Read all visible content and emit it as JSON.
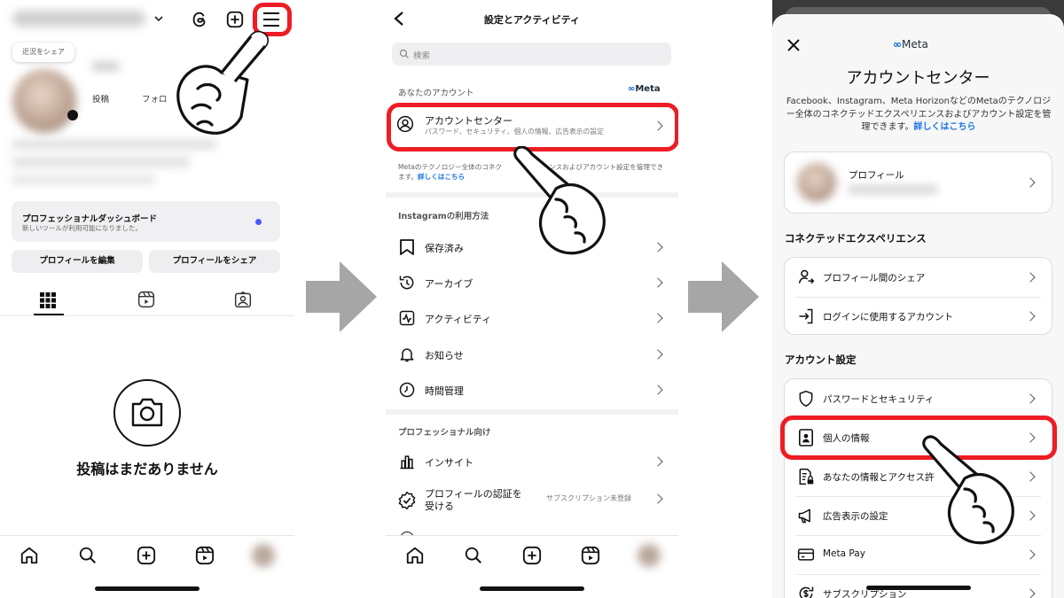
{
  "colors": {
    "accent_red": "#ee1c24",
    "meta_blue": "#0064e0",
    "link_blue": "#1a74e4",
    "arrow_gray": "#a6a6a6",
    "dot_blue": "#4a5cf0"
  },
  "profile_screen": {
    "note_bubble": "近況をシェア",
    "stats": [
      "投稿",
      "フォロ"
    ],
    "dashboard": {
      "title": "プロフェッショナルダッシュボード",
      "subtitle": "新しいツールが利用可能になりました。"
    },
    "edit_button": "プロフィールを編集",
    "share_button": "プロフィールをシェア",
    "empty_text": "投稿はまだありません",
    "icons": [
      "threads-icon",
      "add-icon",
      "menu-icon",
      "grid-icon",
      "reels-icon",
      "tagged-icon",
      "camera-icon"
    ],
    "nav_icons": [
      "home-icon",
      "search-icon",
      "create-icon",
      "reels-icon",
      "profile-avatar"
    ]
  },
  "settings_screen": {
    "title": "設定とアクティビティ",
    "search_placeholder": "検索",
    "your_account_label": "あなたのアカウント",
    "meta_logo": "Meta",
    "account_center": {
      "title": "アカウントセンター",
      "subtitle": "パスワード、セキュリティ、個人の情報、広告表示の設定"
    },
    "account_desc": "Metaのテクノロジー全体のコネク　　　　　　　ンスおよびアカウント設定を管理できます。",
    "account_desc_link": "詳しくはこちら",
    "usage_label": "Instagramの利用方法",
    "usage_items": [
      {
        "label": "保存済み",
        "icon": "bookmark-icon"
      },
      {
        "label": "アーカイブ",
        "icon": "archive-icon"
      },
      {
        "label": "アクティビティ",
        "icon": "activity-icon"
      },
      {
        "label": "お知らせ",
        "icon": "bell-icon"
      },
      {
        "label": "時間管理",
        "icon": "clock-icon"
      }
    ],
    "pro_label": "プロフェッショナル向け",
    "pro_items": [
      {
        "label": "インサイト",
        "icon": "insights-icon",
        "value": ""
      },
      {
        "label": "プロフィールの認証を受ける",
        "icon": "verified-icon",
        "value": "サブスクリプション未登録"
      }
    ]
  },
  "account_center_screen": {
    "meta_logo": "Meta",
    "title": "アカウントセンター",
    "description": "Facebook、Instagram、Meta Horizonなどのメタのテクノロジー全体のコネクテッドエクスペリエンスおよびアカウント設定を管理できます。",
    "description_display": "Facebook、Instagram、Meta HorizonなどのMetaのテクノロジー全体のコネクテッドエクスペリエンスおよびアカウント設定を管理できます。",
    "learn_more": "詳しくはこちら",
    "profile_label": "プロフィール",
    "connected_label": "コネクテッドエクスペリエンス",
    "connected_items": [
      {
        "label": "プロフィール間のシェア",
        "icon": "profile-share-icon"
      },
      {
        "label": "ログインに使用するアカウント",
        "icon": "login-icon"
      }
    ],
    "settings_label": "アカウント設定",
    "settings_items": [
      {
        "label": "パスワードとセキュリティ",
        "icon": "shield-icon"
      },
      {
        "label": "個人の情報",
        "icon": "id-card-icon"
      },
      {
        "label": "あなたの情報とアクセス許",
        "icon": "info-lock-icon"
      },
      {
        "label": "広告表示の設定",
        "icon": "megaphone-icon"
      },
      {
        "label": "Meta Pay",
        "icon": "card-icon"
      },
      {
        "label": "サブスクリプション",
        "icon": "subscription-icon"
      }
    ]
  }
}
